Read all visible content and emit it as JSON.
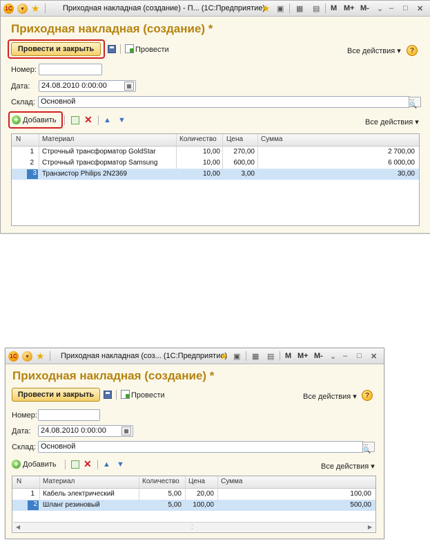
{
  "windows": [
    {
      "titlebar": {
        "logo": "1C",
        "title": "Приходная накладная (создание) - П...  (1С:Предприятие)",
        "m": "M",
        "mplus": "M+",
        "mminus": "M-"
      },
      "heading": "Приходная накладная (создание) *",
      "toolbar": {
        "post_close": "Провести и закрыть",
        "post": "Провести",
        "all_actions": "Все действия ▾",
        "help": "?"
      },
      "fields": {
        "number_label": "Номер:",
        "number_value": "",
        "date_label": "Дата:",
        "date_value": "24.08.2010 0:00:00",
        "warehouse_label": "Склад:",
        "warehouse_value": "Основной"
      },
      "table_toolbar": {
        "add": "Добавить",
        "all_actions": "Все действия ▾"
      },
      "table": {
        "columns": [
          "N",
          "Материал",
          "Количество",
          "Цена",
          "Сумма"
        ],
        "rows": [
          {
            "n": "1",
            "material": "Строчный трансформатор GoldStar",
            "qty": "10,00",
            "price": "270,00",
            "sum": "2 700,00"
          },
          {
            "n": "2",
            "material": "Строчный трансформатор Samsung",
            "qty": "10,00",
            "price": "600,00",
            "sum": "6 000,00"
          },
          {
            "n": "3",
            "material": "Транзистор Philips 2N2369",
            "qty": "10,00",
            "price": "3,00",
            "sum": "30,00"
          }
        ]
      }
    },
    {
      "titlebar": {
        "logo": "1C",
        "title": "Приходная накладная (соз...  (1С:Предприятие)",
        "m": "M",
        "mplus": "M+",
        "mminus": "M-"
      },
      "heading": "Приходная накладная (создание) *",
      "toolbar": {
        "post_close": "Провести и закрыть",
        "post": "Провести",
        "all_actions": "Все действия ▾",
        "help": "?"
      },
      "fields": {
        "number_label": "Номер:",
        "number_value": "",
        "date_label": "Дата:",
        "date_value": "24.08.2010 0:00:00",
        "warehouse_label": "Склад:",
        "warehouse_value": "Основной"
      },
      "table_toolbar": {
        "add": "Добавить",
        "all_actions": "Все действия ▾"
      },
      "table": {
        "columns": [
          "N",
          "Материал",
          "Количество",
          "Цена",
          "Сумма"
        ],
        "rows": [
          {
            "n": "1",
            "material": "Кабель электрический",
            "qty": "5,00",
            "price": "20,00",
            "sum": "100,00"
          },
          {
            "n": "2",
            "material": "Шланг резиновый",
            "qty": "5,00",
            "price": "100,00",
            "sum": "500,00"
          }
        ]
      }
    }
  ]
}
